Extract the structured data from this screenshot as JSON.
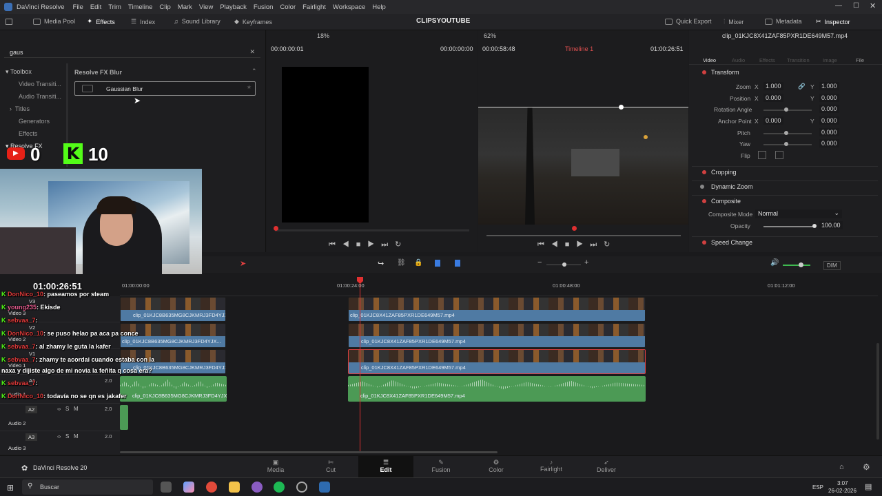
{
  "app": {
    "title": "DaVinci Resolve",
    "project": "CLIPSYOUTUBE",
    "version_label": "DaVinci Resolve 20"
  },
  "menu": [
    "File",
    "Edit",
    "Trim",
    "Timeline",
    "Clip",
    "Mark",
    "View",
    "Playback",
    "Fusion",
    "Color",
    "Fairlight",
    "Workspace",
    "Help"
  ],
  "toolbar": {
    "media_pool": "Media Pool",
    "effects": "Effects",
    "index": "Index",
    "sound_library": "Sound Library",
    "keyframes": "Keyframes",
    "quick_export": "Quick Export",
    "mixer": "Mixer",
    "metadata": "Metadata",
    "inspector": "Inspector"
  },
  "effects": {
    "search_value": "gaus",
    "toolbox": "Toolbox",
    "video_transitions": "Video Transiti...",
    "audio_transitions": "Audio Transiti...",
    "titles": "Titles",
    "generators": "Generators",
    "effects": "Effects",
    "resolve_fx": "Resolve FX",
    "group_title": "Resolve FX Blur",
    "result": "Gaussian Blur"
  },
  "source_viewer": {
    "zoom": "18%",
    "timecode_left": "00:00:00:01",
    "timecode_right": "00:00:00:00"
  },
  "timeline_viewer": {
    "zoom": "62%",
    "timecode_left": "00:00:58:48",
    "timeline_name": "Timeline 1",
    "timecode_right": "01:00:26:51"
  },
  "inspector": {
    "clip_name": "clip_01KJC8X41ZAF85PXR1DE649M57.mp4",
    "tabs": [
      "Video",
      "Audio",
      "Effects",
      "Transition",
      "Image",
      "File"
    ],
    "transform": "Transform",
    "zoom_label": "Zoom",
    "zoom_x": "1.000",
    "zoom_y": "1.000",
    "position_label": "Position",
    "position_x": "0.000",
    "position_y": "0.000",
    "rotation_label": "Rotation Angle",
    "rotation": "0.000",
    "anchor_label": "Anchor Point",
    "anchor_x": "0.000",
    "anchor_y": "0.000",
    "pitch_label": "Pitch",
    "pitch": "0.000",
    "yaw_label": "Yaw",
    "yaw": "0.000",
    "flip_label": "Flip",
    "cropping": "Cropping",
    "dynamic_zoom": "Dynamic Zoom",
    "composite": "Composite",
    "composite_mode_label": "Composite Mode",
    "composite_mode": "Normal",
    "opacity_label": "Opacity",
    "opacity": "100.00",
    "speed_change": "Speed Change",
    "x": "X",
    "y": "Y"
  },
  "timeline": {
    "dim": "DIM",
    "ruler": [
      "01:00:00:00",
      "01:00:24:00",
      "01:00:48:00",
      "01:01:12:00"
    ],
    "overlay_timecode": "01:00:26:51",
    "tracks": [
      {
        "id": "V3",
        "name": "Video 3"
      },
      {
        "id": "V2",
        "name": "Video 2"
      },
      {
        "id": "V1",
        "name": "Video 1"
      },
      {
        "id": "A1",
        "name": "Audio 1",
        "level": "2.0"
      },
      {
        "id": "A2",
        "name": "Audio 2",
        "level": "2.0"
      },
      {
        "id": "A3",
        "name": "Audio 3",
        "level": "2.0"
      }
    ],
    "clip_a": "clip_01KJC8B635MG8CJKMRJ3FD4YJX...",
    "clip_b": "clip_01KJC8X41ZAF85PXR1DE649M57.mp4"
  },
  "stream_overlay": {
    "youtube_count": "0",
    "kick_count": "10"
  },
  "chat": [
    {
      "user": "DonNico_10",
      "msg": ": paseamos por steam"
    },
    {
      "user": "young235",
      "msg": ": Ekisde"
    },
    {
      "user": "sebvaa_7",
      "msg": ":"
    },
    {
      "user": "DonNico_10",
      "msg": ": se puso helao pa aca pa conce"
    },
    {
      "user": "sebvaa_7",
      "msg": ": al zhamy le guta la kafer"
    },
    {
      "user": "sebvaa_7",
      "msg": ": zhamy te acordai cuando estaba con la"
    },
    {
      "user": "",
      "msg": "naxa y dijiste algo de mi novia la feñita q cosa era?"
    },
    {
      "user": "sebvaa_7",
      "msg": ":"
    },
    {
      "user": "DonNico_10",
      "msg": ": todavía no se qn es jakafer"
    }
  ],
  "pages": [
    "Media",
    "Cut",
    "Edit",
    "Fusion",
    "Color",
    "Fairlight",
    "Deliver"
  ],
  "taskbar": {
    "search": "Buscar",
    "lang": "ESP",
    "time": "3:07",
    "date": "26-02-2026"
  },
  "colors": {
    "accent_red": "#e04040",
    "clip_blue": "#4f7aa3",
    "clip_green": "#4c9a55",
    "playhead": "#e03030"
  }
}
